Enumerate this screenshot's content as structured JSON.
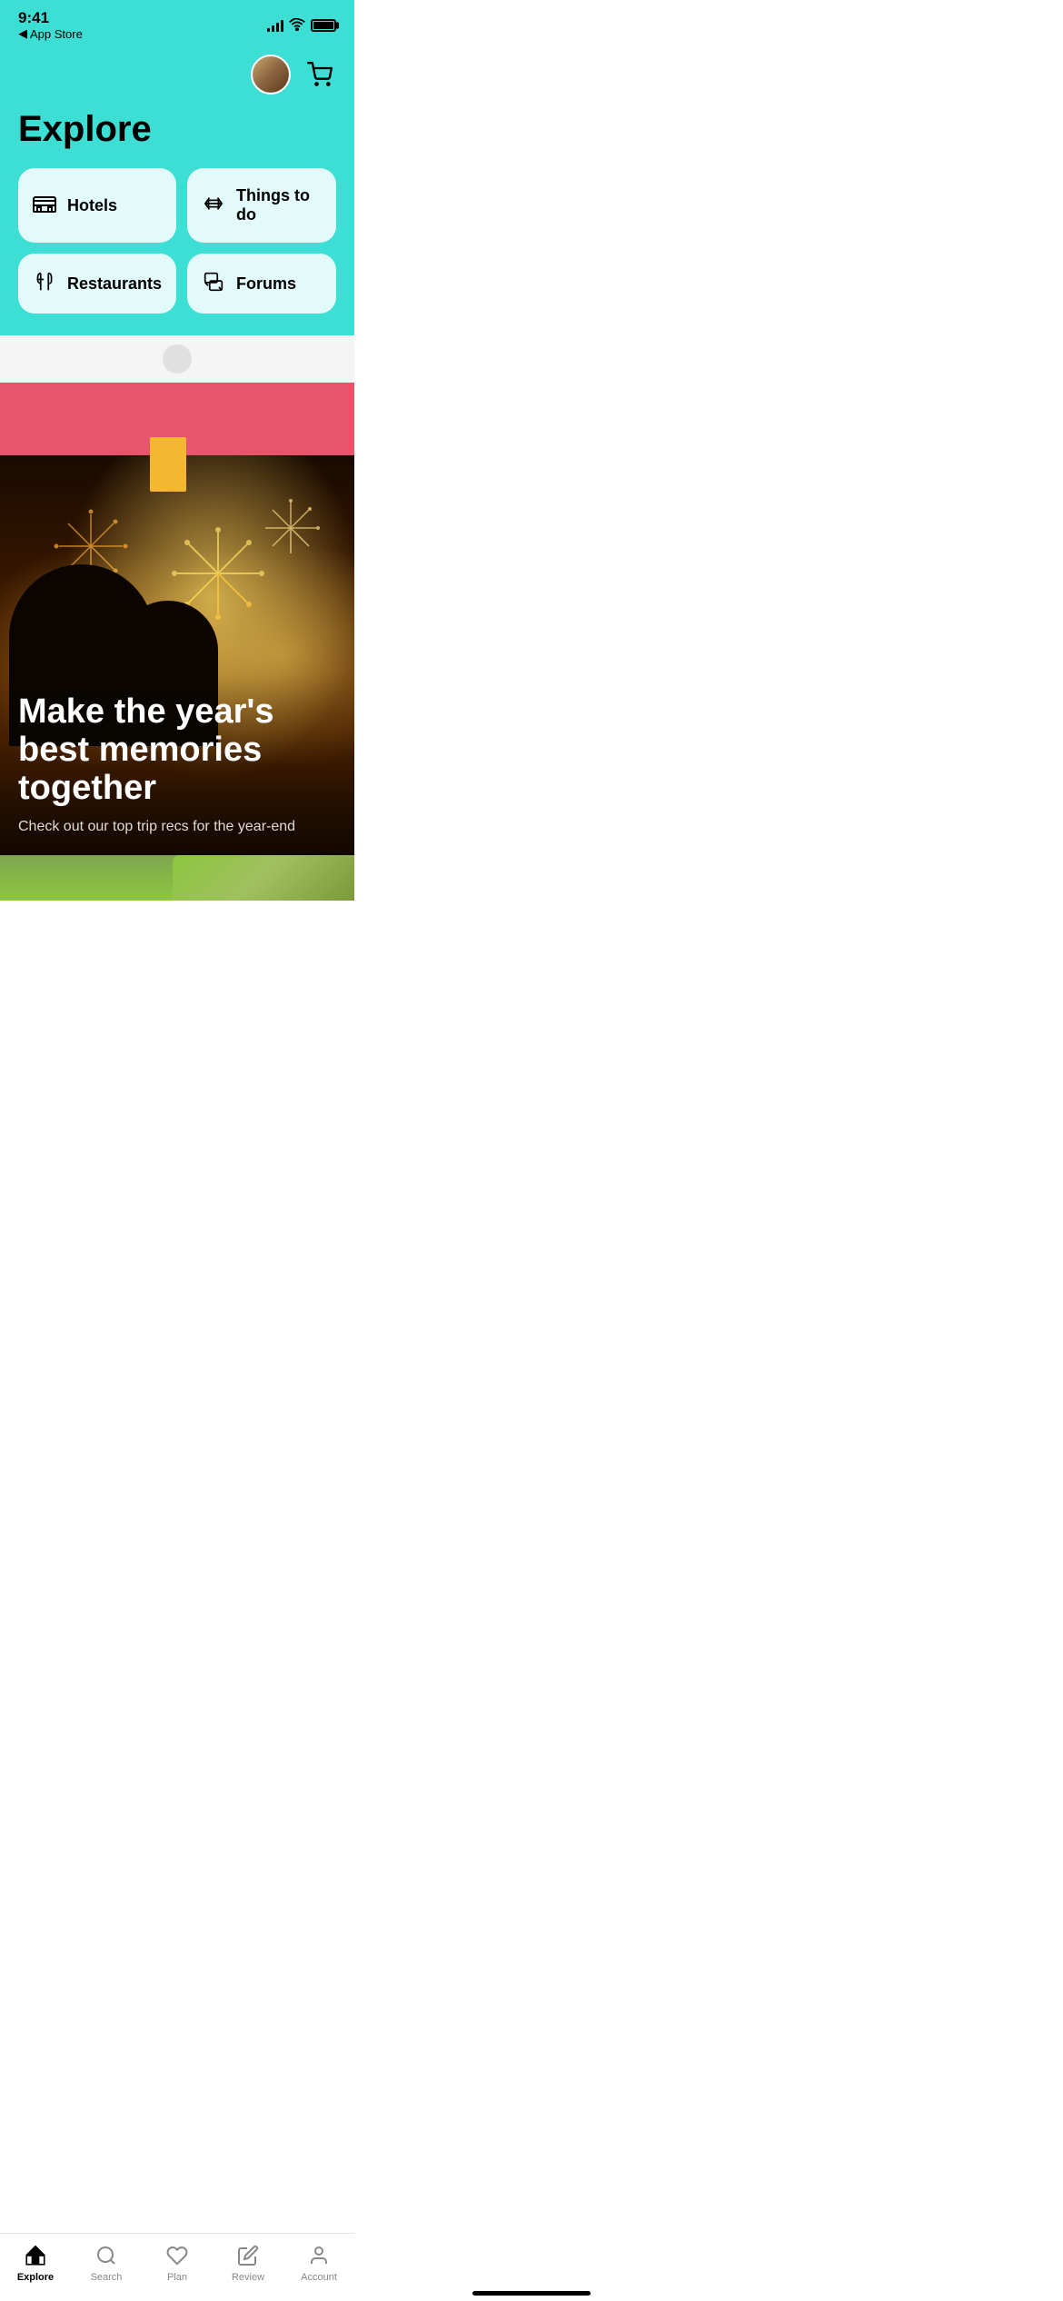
{
  "statusBar": {
    "time": "9:41",
    "appStore": "App Store",
    "backArrow": "◀"
  },
  "header": {
    "title": "Explore"
  },
  "categories": [
    {
      "id": "hotels",
      "label": "Hotels",
      "icon": "🛏"
    },
    {
      "id": "things-to-do",
      "label": "Things to do",
      "icon": "🎟"
    },
    {
      "id": "restaurants",
      "label": "Restaurants",
      "icon": "🍴"
    },
    {
      "id": "forums",
      "label": "Forums",
      "icon": "💬"
    }
  ],
  "hero": {
    "headline": "Make the year's best memories together",
    "subtext": "Check out our top trip recs for the year-end"
  },
  "bottomNav": [
    {
      "id": "explore",
      "label": "Explore",
      "active": true
    },
    {
      "id": "search",
      "label": "Search",
      "active": false
    },
    {
      "id": "plan",
      "label": "Plan",
      "active": false
    },
    {
      "id": "review",
      "label": "Review",
      "active": false
    },
    {
      "id": "account",
      "label": "Account",
      "active": false
    }
  ]
}
